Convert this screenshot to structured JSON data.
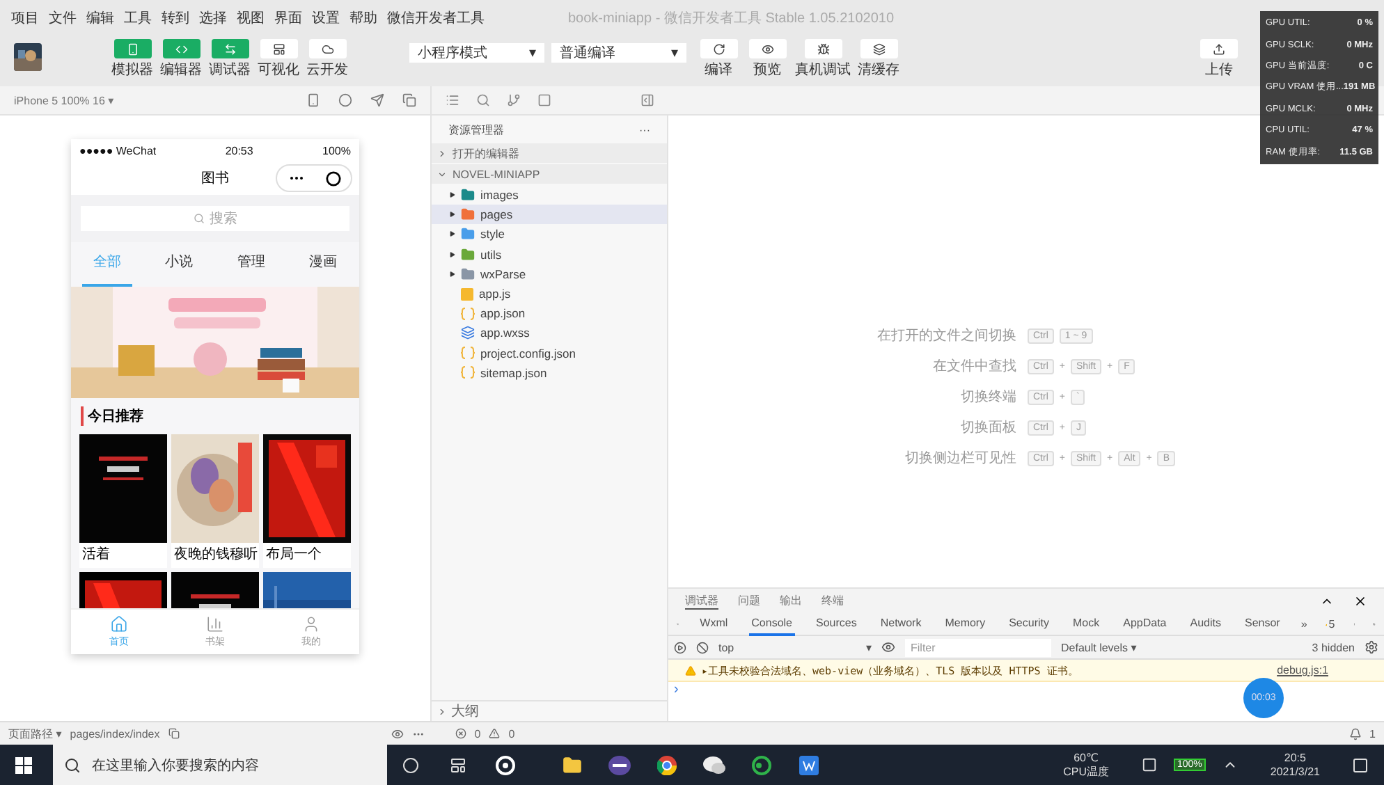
{
  "menu_bar": {
    "items": [
      "项目",
      "文件",
      "编辑",
      "工具",
      "转到",
      "选择",
      "视图",
      "界面",
      "设置",
      "帮助",
      "微信开发者工具"
    ],
    "title": "book-miniapp - 微信开发者工具 Stable 1.05.2102010"
  },
  "toolbar": {
    "avatar": {
      "kind": "picture"
    },
    "modes": [
      {
        "label": "模拟器",
        "selected": true
      },
      {
        "label": "编辑器",
        "selected": true
      },
      {
        "label": "调试器",
        "selected": true
      },
      {
        "label": "可视化",
        "selected": false
      },
      {
        "label": "云开发",
        "selected": false
      }
    ],
    "selects": [
      {
        "value": "小程序模式",
        "caret": "▾"
      },
      {
        "value": "普通编译",
        "caret": "▾"
      }
    ],
    "actions": [
      {
        "label": "编译"
      },
      {
        "label": "预览"
      },
      {
        "label": "真机调试"
      },
      {
        "label": "清缓存"
      }
    ],
    "upload": {
      "label": "上传"
    }
  },
  "simulator": {
    "device": "iPhone 5 100% 16 ▾",
    "phone": {
      "carrier": "●●●●● WeChat",
      "time": "20:53",
      "battery": "100%",
      "nav_title": "图书",
      "search_placeholder": "搜索",
      "tabs": [
        {
          "label": "全部",
          "selected": true
        },
        {
          "label": "小说",
          "selected": false
        },
        {
          "label": "管理",
          "selected": false
        },
        {
          "label": "漫画",
          "selected": false
        }
      ],
      "section_title": "今日推荐",
      "books": [
        {
          "kind": "picture",
          "title": "活着"
        },
        {
          "kind": "picture",
          "title": "夜晚的钱穆听"
        },
        {
          "kind": "picture",
          "title": "布局一个"
        },
        {
          "kind": "picture"
        },
        {
          "kind": "picture"
        },
        {
          "kind": "picture"
        }
      ],
      "tab_bar": [
        {
          "label": "首页",
          "selected": true
        },
        {
          "label": "书架",
          "selected": false
        },
        {
          "label": "我的",
          "selected": false
        }
      ]
    }
  },
  "explorer": {
    "title": "资源管理器",
    "more": "···",
    "sections": [
      {
        "label": "打开的编辑器",
        "expanded": false
      },
      {
        "label": "NOVEL-MINIAPP",
        "expanded": true
      }
    ],
    "files": [
      {
        "name": "images",
        "kind": "folder",
        "color": "#1b8a8a",
        "expanded": false,
        "selected": false
      },
      {
        "name": "pages",
        "kind": "folder",
        "color": "#f0703a",
        "expanded": false,
        "selected": true
      },
      {
        "name": "style",
        "kind": "folder",
        "color": "#4a9eea",
        "expanded": false,
        "selected": false
      },
      {
        "name": "utils",
        "kind": "folder",
        "color": "#6aa83a",
        "expanded": false,
        "selected": false
      },
      {
        "name": "wxParse",
        "kind": "folder",
        "color": "#8a96a6",
        "expanded": false,
        "selected": false
      },
      {
        "name": "app.js",
        "kind": "js",
        "selected": false
      },
      {
        "name": "app.json",
        "kind": "json",
        "selected": false
      },
      {
        "name": "app.wxss",
        "kind": "wxss",
        "selected": false
      },
      {
        "name": "project.config.json",
        "kind": "json",
        "selected": false
      },
      {
        "name": "sitemap.json",
        "kind": "json",
        "selected": false
      }
    ],
    "outline": "大纲"
  },
  "editor": {
    "shortcuts": [
      {
        "label": "在打开的文件之间切换",
        "keys": [
          {
            "kind": "key",
            "text": "Ctrl"
          },
          {
            "kind": "key",
            "text": "1 ~ 9"
          }
        ]
      },
      {
        "label": "在文件中查找",
        "keys": [
          {
            "kind": "key",
            "text": "Ctrl"
          },
          {
            "kind": "plus",
            "text": "+"
          },
          {
            "kind": "key",
            "text": "Shift"
          },
          {
            "kind": "plus",
            "text": "+"
          },
          {
            "kind": "key",
            "text": "F"
          }
        ]
      },
      {
        "label": "切换终端",
        "keys": [
          {
            "kind": "key",
            "text": "Ctrl"
          },
          {
            "kind": "plus",
            "text": "+"
          },
          {
            "kind": "key",
            "text": "`"
          }
        ]
      },
      {
        "label": "切换面板",
        "keys": [
          {
            "kind": "key",
            "text": "Ctrl"
          },
          {
            "kind": "plus",
            "text": "+"
          },
          {
            "kind": "key",
            "text": "J"
          }
        ]
      },
      {
        "label": "切换侧边栏可见性",
        "keys": [
          {
            "kind": "key",
            "text": "Ctrl"
          },
          {
            "kind": "plus",
            "text": "+"
          },
          {
            "kind": "key",
            "text": "Shift"
          },
          {
            "kind": "plus",
            "text": "+"
          },
          {
            "kind": "key",
            "text": "Alt"
          },
          {
            "kind": "plus",
            "text": "+"
          },
          {
            "kind": "key",
            "text": "B"
          }
        ]
      }
    ]
  },
  "debugger": {
    "panel_tabs": [
      {
        "label": "调试器",
        "selected": true
      },
      {
        "label": "问题",
        "selected": false
      },
      {
        "label": "输出",
        "selected": false
      },
      {
        "label": "终端",
        "selected": false
      }
    ],
    "devtools_tabs": [
      {
        "label": "Wxml",
        "selected": false
      },
      {
        "label": "Console",
        "selected": true
      },
      {
        "label": "Sources",
        "selected": false
      },
      {
        "label": "Network",
        "selected": false
      },
      {
        "label": "Memory",
        "selected": false
      },
      {
        "label": "Security",
        "selected": false
      },
      {
        "label": "Mock",
        "selected": false
      },
      {
        "label": "AppData",
        "selected": false
      },
      {
        "label": "Audits",
        "selected": false
      },
      {
        "label": "Sensor",
        "selected": false
      }
    ],
    "overflow": "»",
    "warnings": "5",
    "context": "top",
    "context_caret": "▾",
    "filter_placeholder": "Filter",
    "levels": "Default levels ▾",
    "hidden": "3 hidden",
    "message": "▸工具未校验合法域名、web-view（业务域名）、TLS 版本以及 HTTPS 证书。",
    "source_link": "debug.js:1",
    "timer": "00:03",
    "prompt": "›"
  },
  "status_bar": {
    "page_path_label": "页面路径 ▾",
    "page_path": "pages/index/index",
    "errors": "0",
    "warnings": "0",
    "notifications": "1"
  },
  "taskbar": {
    "search_placeholder": "在这里输入你要搜索的内容",
    "temperature": "60℃",
    "temperature_label": "CPU温度",
    "battery": "100%",
    "time": "20:5",
    "date": "2021/3/21"
  },
  "gpu_panel": {
    "rows": [
      {
        "label": "GPU UTIL:",
        "value": "0 %"
      },
      {
        "label": "GPU SCLK:",
        "value": "0 MHz"
      },
      {
        "label": "GPU 当前温度:",
        "value": "0 C"
      },
      {
        "label": "GPU VRAM 使用...",
        "value": "191 MB"
      },
      {
        "label": "GPU MCLK:",
        "value": "0 MHz"
      },
      {
        "label": "CPU UTIL:",
        "value": "47 %"
      },
      {
        "label": "RAM 使用率:",
        "value": "11.5 GB"
      }
    ]
  }
}
